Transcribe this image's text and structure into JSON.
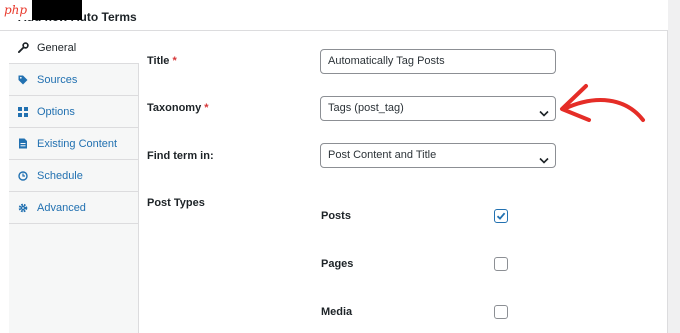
{
  "header": {
    "title": "Add new Auto Terms",
    "logo_text": "php"
  },
  "sidebar": {
    "items": [
      {
        "label": "General",
        "icon": "wrench-icon",
        "active": true
      },
      {
        "label": "Sources",
        "icon": "tag-icon",
        "active": false
      },
      {
        "label": "Options",
        "icon": "grid-icon",
        "active": false
      },
      {
        "label": "Existing Content",
        "icon": "document-icon",
        "active": false
      },
      {
        "label": "Schedule",
        "icon": "clock-icon",
        "active": false
      },
      {
        "label": "Advanced",
        "icon": "gear-icon",
        "active": false
      }
    ]
  },
  "form": {
    "title": {
      "label": "Title",
      "required": "*",
      "value": "Automatically Tag Posts"
    },
    "taxonomy": {
      "label": "Taxonomy",
      "required": "*",
      "value": "Tags (post_tag)"
    },
    "find_term": {
      "label": "Find term in:",
      "value": "Post Content and Title"
    },
    "post_types": {
      "label": "Post Types",
      "items": [
        {
          "label": "Posts",
          "checked": true
        },
        {
          "label": "Pages",
          "checked": false
        },
        {
          "label": "Media",
          "checked": false
        }
      ]
    }
  },
  "colors": {
    "accent": "#2271b1",
    "annotation": "#e52d27",
    "required": "#d63638"
  }
}
